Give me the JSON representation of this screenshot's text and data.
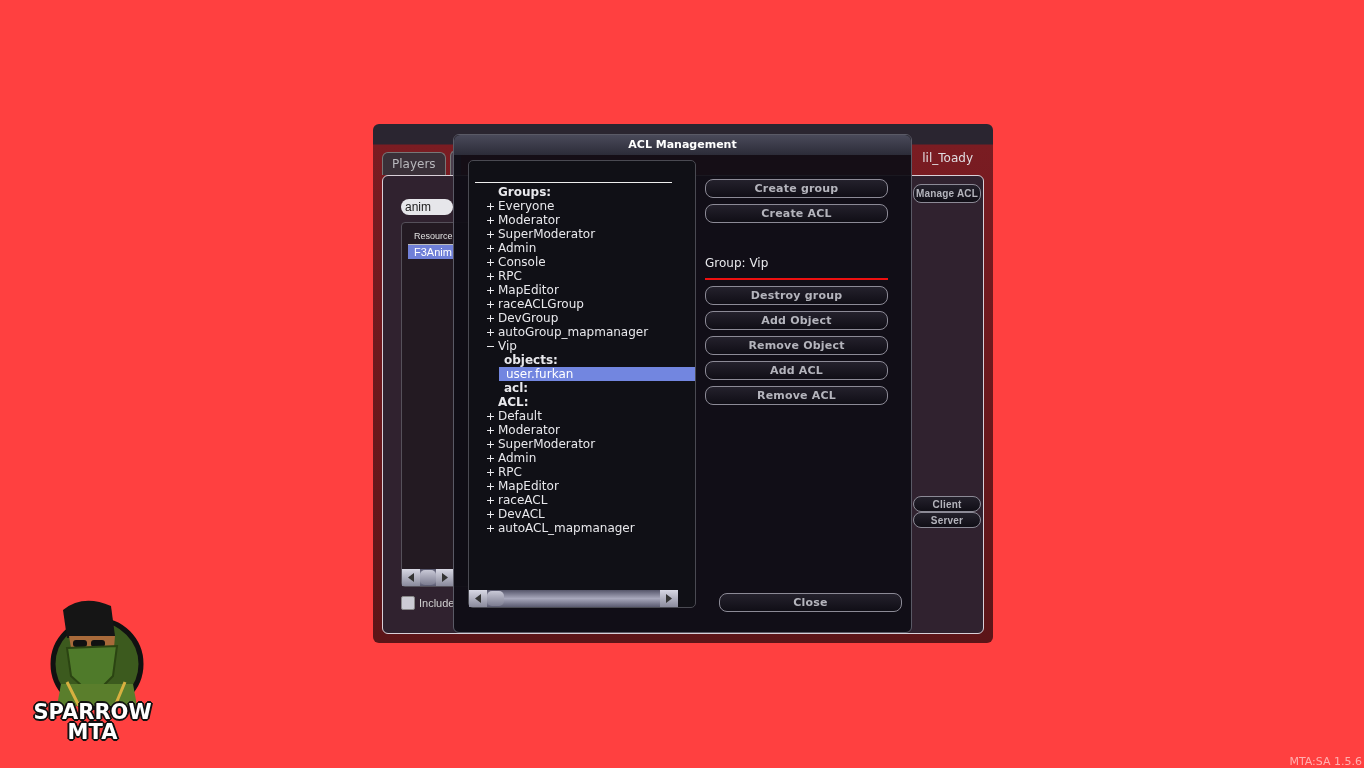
{
  "admin_panel": {
    "tabs": [
      {
        "label": "Players",
        "selected": false
      },
      {
        "selected": true
      }
    ],
    "credit": "lil_Toady",
    "search": {
      "value": "anim"
    },
    "resource_list": {
      "columns": [
        "Resource"
      ],
      "rows": [
        {
          "name": "F3Anim",
          "selected": true
        }
      ]
    },
    "manage_acl_button": "Manage ACL",
    "command_buttons": [
      "Client",
      "Server"
    ],
    "include_checkbox": {
      "label": "Include",
      "checked": false
    }
  },
  "acl_window": {
    "title": "ACL Management",
    "tree": [
      {
        "kind": "header",
        "label": "Groups:",
        "children": [
          {
            "kind": "item",
            "label": "Everyone",
            "expanded": false,
            "selected": false
          },
          {
            "kind": "item",
            "label": "Moderator",
            "expanded": false,
            "selected": false
          },
          {
            "kind": "item",
            "label": "SuperModerator",
            "expanded": false,
            "selected": false
          },
          {
            "kind": "item",
            "label": "Admin",
            "expanded": false,
            "selected": false
          },
          {
            "kind": "item",
            "label": "Console",
            "expanded": false,
            "selected": false
          },
          {
            "kind": "item",
            "label": "RPC",
            "expanded": false,
            "selected": false
          },
          {
            "kind": "item",
            "label": "MapEditor",
            "expanded": false,
            "selected": false
          },
          {
            "kind": "item",
            "label": "raceACLGroup",
            "expanded": false,
            "selected": false
          },
          {
            "kind": "item",
            "label": "DevGroup",
            "expanded": false,
            "selected": false
          },
          {
            "kind": "item",
            "label": "autoGroup_mapmanager",
            "expanded": false,
            "selected": false
          },
          {
            "kind": "item",
            "label": "Vip",
            "expanded": true,
            "selected": false,
            "children": [
              {
                "kind": "header",
                "label": "objects:",
                "children": [
                  {
                    "kind": "leaf",
                    "label": "user.furkan",
                    "selected": true
                  }
                ]
              },
              {
                "kind": "header",
                "label": "acl:"
              }
            ]
          }
        ]
      },
      {
        "kind": "header",
        "label": "ACL:",
        "children": [
          {
            "kind": "item",
            "label": "Default",
            "expanded": false,
            "selected": false
          },
          {
            "kind": "item",
            "label": "Moderator",
            "expanded": false,
            "selected": false
          },
          {
            "kind": "item",
            "label": "SuperModerator",
            "expanded": false,
            "selected": false
          },
          {
            "kind": "item",
            "label": "Admin",
            "expanded": false,
            "selected": false
          },
          {
            "kind": "item",
            "label": "RPC",
            "expanded": false,
            "selected": false
          },
          {
            "kind": "item",
            "label": "MapEditor",
            "expanded": false,
            "selected": false
          },
          {
            "kind": "item",
            "label": "raceACL",
            "expanded": false,
            "selected": false
          },
          {
            "kind": "item",
            "label": "DevACL",
            "expanded": false,
            "selected": false
          },
          {
            "kind": "item",
            "label": "autoACL_mapmanager",
            "expanded": false,
            "selected": false
          }
        ]
      }
    ],
    "top_buttons": [
      "Create group",
      "Create ACL"
    ],
    "group_label": "Group: Vip",
    "group_buttons": [
      "Destroy group",
      "Add Object",
      "Remove Object",
      "Add ACL",
      "Remove ACL"
    ],
    "close_button": "Close"
  },
  "logo": {
    "line_1": "SPARROW",
    "line_2": "MTA"
  },
  "version": "MTA:SA 1.5.6"
}
